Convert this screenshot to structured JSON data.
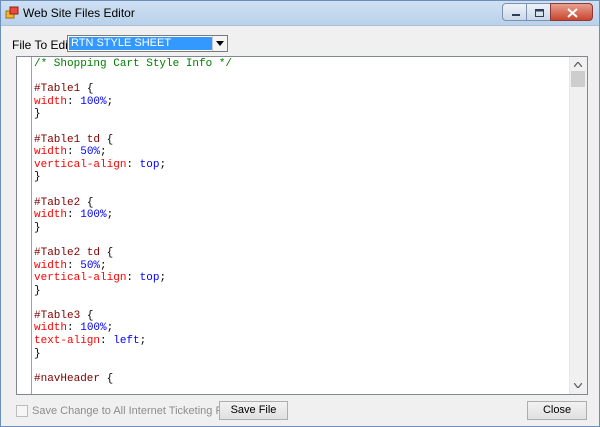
{
  "window": {
    "title": "Web Site Files Editor",
    "icon": "app-icon",
    "buttons": [
      "minimize",
      "maximize",
      "close"
    ]
  },
  "file_to_edit": {
    "label": "File To Edit",
    "selected": "RTN STYLE SHEET"
  },
  "editor": {
    "lines": [
      [
        {
          "t": "/* Shopping Cart Style Info */",
          "c": "comment"
        }
      ],
      [],
      [
        {
          "t": "#Table1 ",
          "c": "selector"
        },
        {
          "t": "{",
          "c": "brace"
        }
      ],
      [
        {
          "t": "width",
          "c": "prop"
        },
        {
          "t": ": ",
          "c": "punct"
        },
        {
          "t": "100%",
          "c": "value"
        },
        {
          "t": ";",
          "c": "punct"
        }
      ],
      [
        {
          "t": "}",
          "c": "brace"
        }
      ],
      [],
      [
        {
          "t": "#Table1 td ",
          "c": "selector"
        },
        {
          "t": "{",
          "c": "brace"
        }
      ],
      [
        {
          "t": "width",
          "c": "prop"
        },
        {
          "t": ": ",
          "c": "punct"
        },
        {
          "t": "50%",
          "c": "value"
        },
        {
          "t": ";",
          "c": "punct"
        }
      ],
      [
        {
          "t": "vertical-align",
          "c": "prop"
        },
        {
          "t": ": ",
          "c": "punct"
        },
        {
          "t": "top",
          "c": "value"
        },
        {
          "t": ";",
          "c": "punct"
        }
      ],
      [
        {
          "t": "}",
          "c": "brace"
        }
      ],
      [],
      [
        {
          "t": "#Table2 ",
          "c": "selector"
        },
        {
          "t": "{",
          "c": "brace"
        }
      ],
      [
        {
          "t": "width",
          "c": "prop"
        },
        {
          "t": ": ",
          "c": "punct"
        },
        {
          "t": "100%",
          "c": "value"
        },
        {
          "t": ";",
          "c": "punct"
        }
      ],
      [
        {
          "t": "}",
          "c": "brace"
        }
      ],
      [],
      [
        {
          "t": "#Table2 td ",
          "c": "selector"
        },
        {
          "t": "{",
          "c": "brace"
        }
      ],
      [
        {
          "t": "width",
          "c": "prop"
        },
        {
          "t": ": ",
          "c": "punct"
        },
        {
          "t": "50%",
          "c": "value"
        },
        {
          "t": ";",
          "c": "punct"
        }
      ],
      [
        {
          "t": "vertical-align",
          "c": "prop"
        },
        {
          "t": ": ",
          "c": "punct"
        },
        {
          "t": "top",
          "c": "value"
        },
        {
          "t": ";",
          "c": "punct"
        }
      ],
      [
        {
          "t": "}",
          "c": "brace"
        }
      ],
      [],
      [
        {
          "t": "#Table3 ",
          "c": "selector"
        },
        {
          "t": "{",
          "c": "brace"
        }
      ],
      [
        {
          "t": "width",
          "c": "prop"
        },
        {
          "t": ": ",
          "c": "punct"
        },
        {
          "t": "100%",
          "c": "value"
        },
        {
          "t": ";",
          "c": "punct"
        }
      ],
      [
        {
          "t": "text-align",
          "c": "prop"
        },
        {
          "t": ": ",
          "c": "punct"
        },
        {
          "t": "left",
          "c": "value"
        },
        {
          "t": ";",
          "c": "punct"
        }
      ],
      [
        {
          "t": "}",
          "c": "brace"
        }
      ],
      [],
      [
        {
          "t": "#navHeader ",
          "c": "selector"
        },
        {
          "t": "{",
          "c": "brace"
        }
      ]
    ]
  },
  "footer": {
    "checkbox_label": "Save Change to All Internet Ticketing Pages",
    "checkbox_checked": false,
    "checkbox_enabled": false,
    "save_label": "Save File",
    "close_label": "Close"
  },
  "colors": {
    "comment": "#008000",
    "selector": "#800000",
    "property": "#ff0000",
    "value": "#0000ff",
    "selection": "#3399ff"
  }
}
